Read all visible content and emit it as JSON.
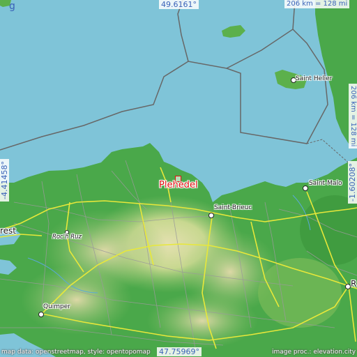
{
  "map": {
    "target_place": "Plehedel",
    "coordinates": {
      "north": "49.6161°",
      "south": "47.75969°",
      "west": "-4.41458°",
      "east": "-1.60208°"
    },
    "scale_top": "206 km = 128 mi",
    "scale_side": "206 km = 128 mi",
    "cities": {
      "saint_helier": "Saint Helier",
      "saint_malo": "Saint-Malo",
      "saint_brieuc": "Saint-Brieuc",
      "brest": "rest",
      "roc_h_ruz": "Roc'h Ruz",
      "quimper": "Quimper",
      "rennes": "R",
      "guernsey_fragment": "g"
    },
    "credits_left": "map data: openstreetmap, style: opentopomap",
    "credits_right": "image proc.: elevation.city",
    "colors": {
      "sea": "#7fc4d8",
      "land_green": "#3f9e3f",
      "land_light": "#a8d27a",
      "roads": "#e8e83a",
      "target": "#e01010",
      "coord_text": "#3a62b8"
    }
  }
}
